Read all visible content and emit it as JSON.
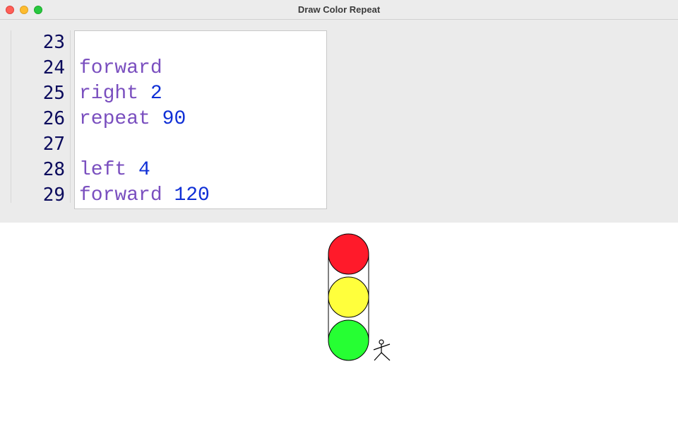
{
  "window": {
    "title": "Draw Color Repeat"
  },
  "editor": {
    "lines": [
      {
        "number": "23",
        "keyword": "",
        "argument": ""
      },
      {
        "number": "24",
        "keyword": "forward",
        "argument": ""
      },
      {
        "number": "25",
        "keyword": "right",
        "argument": "2"
      },
      {
        "number": "26",
        "keyword": "repeat",
        "argument": "90"
      },
      {
        "number": "27",
        "keyword": "",
        "argument": ""
      },
      {
        "number": "28",
        "keyword": "left",
        "argument": "4"
      },
      {
        "number": "29",
        "keyword": "forward",
        "argument": "120"
      }
    ]
  },
  "colors": {
    "keyword": "#7a4fbf",
    "number": "#0f2fd6",
    "line_number": "#0a0a5c",
    "red_light": "#ff1a2a",
    "yellow_light": "#ffff3c",
    "green_light": "#26ff33"
  },
  "drawing": {
    "lights": [
      "red",
      "yellow",
      "green"
    ],
    "turtle": "stick-figure-icon"
  }
}
